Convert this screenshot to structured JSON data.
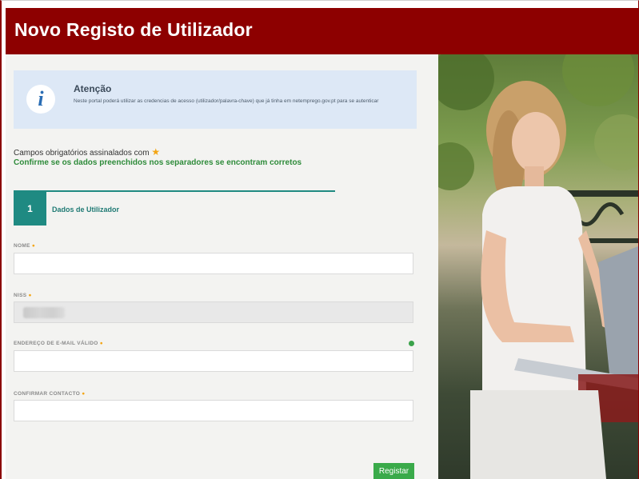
{
  "header": {
    "title": "Novo Registo de Utilizador"
  },
  "info": {
    "title": "Atenção",
    "text": "Neste portal poderá utilizar as credencias de acesso (utilizador/palavra-chave) que já tinha em netemprego.gov.pt para se autenticar"
  },
  "notes": {
    "required": "Campos obrigatórios assinalados com",
    "confirm": "Confirme se os dados preenchidos nos separadores se encontram corretos"
  },
  "step": {
    "number": "1",
    "label": "Dados de Utilizador"
  },
  "fields": {
    "nome": {
      "label": "NOME",
      "value": ""
    },
    "niss": {
      "label": "NISS",
      "value": ""
    },
    "email": {
      "label": "ENDEREÇO DE E-MAIL VÁLIDO",
      "value": ""
    },
    "confirm": {
      "label": "CONFIRMAR CONTACTO",
      "value": ""
    }
  },
  "actions": {
    "submit": "Registar"
  },
  "colors": {
    "header_bg": "#8d0000",
    "accent_teal": "#1f8a82",
    "success_green": "#3aaa4a",
    "required_star": "#f3a515"
  },
  "icons": {
    "info": "info-icon",
    "required": "star-icon",
    "email_hint": "info-dot-icon"
  }
}
